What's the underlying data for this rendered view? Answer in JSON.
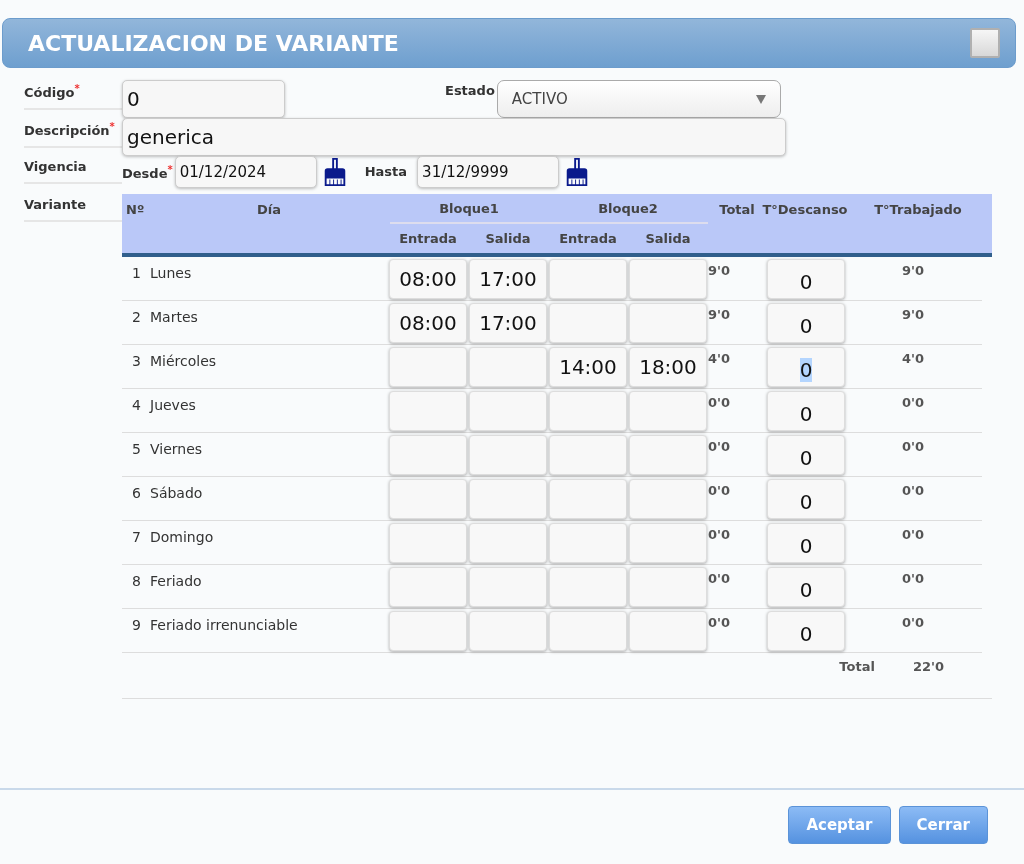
{
  "window": {
    "title": "ACTUALIZACION DE VARIANTE"
  },
  "form": {
    "code": {
      "label": "Código$^{*}$",
      "value": "0"
    },
    "status": {
      "label": "Estado",
      "value": "ACTIVO"
    },
    "description": {
      "label": "Descripción$^{*}$",
      "value": "generica"
    },
    "validity": {
      "label": "Vigencia",
      "from_label": "Desde$^{*}$",
      "from": "01/12/2024",
      "to_label": "Hasta",
      "to": "31/12/9999"
    },
    "variant_label": "Variante"
  },
  "table": {
    "headers": {
      "num": "Nº",
      "day": "Día",
      "block1": "Bloque1",
      "block2": "Bloque2",
      "total": "Total",
      "rest": "T°Descanso",
      "worked": "T°Trabajado",
      "in1": "Entrada",
      "out1": "Salida",
      "in2": "Entrada",
      "out2": "Salida"
    },
    "rows": [
      {
        "num": "1",
        "day": "Lunes",
        "b1_in": "08:00",
        "b1_out": "17:00",
        "total": "9'0",
        "rest": "0",
        "worked": "9'0",
        "rest_highlighted": false
      },
      {
        "num": "2",
        "day": "Martes",
        "b1_in": "08:00",
        "b1_out": "17:00",
        "total": "9'0",
        "rest": "0",
        "worked": "9'0",
        "rest_highlighted": false
      },
      {
        "num": "3",
        "day": "Miércoles",
        "b2_in": "14:00",
        "b2_out": "18:00",
        "total": "4'0",
        "rest": "0",
        "worked": "4'0",
        "rest_highlighted": true
      },
      {
        "num": "4",
        "day": "Jueves",
        "total": "0'0",
        "rest": "0",
        "worked": "0'0",
        "rest_highlighted": false
      },
      {
        "num": "5",
        "day": "Viernes",
        "total": "0'0",
        "rest": "0",
        "worked": "0'0",
        "rest_highlighted": false
      },
      {
        "num": "6",
        "day": "Sábado",
        "total": "0'0",
        "rest": "0",
        "worked": "0'0",
        "rest_highlighted": false
      },
      {
        "num": "7",
        "day": "Domingo",
        "total": "0'0",
        "rest": "0",
        "worked": "0'0",
        "rest_highlighted": false
      },
      {
        "num": "8",
        "day": "Feriado",
        "total": "0'0",
        "rest": "0",
        "worked": "0'0",
        "rest_highlighted": false
      },
      {
        "num": "9",
        "day": "Feriado irrenunciable",
        "total": "0'0",
        "rest": "0",
        "worked": "0'0",
        "rest_highlighted": false
      }
    ],
    "footer": {
      "label": "Total",
      "value": "22'0"
    }
  },
  "buttons": [
    "Aceptar",
    "Cerrar"
  ]
}
